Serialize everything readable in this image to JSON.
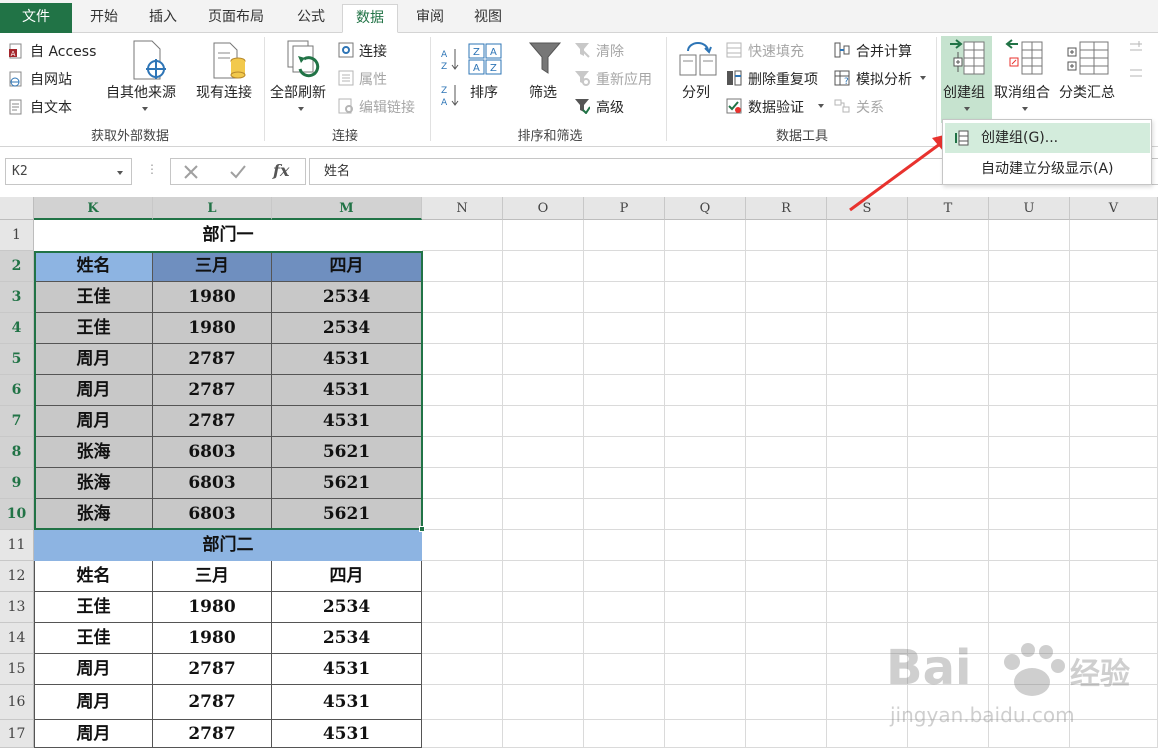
{
  "tabs": [
    "文件",
    "开始",
    "插入",
    "页面布局",
    "公式",
    "数据",
    "审阅",
    "视图"
  ],
  "active_tab": "数据",
  "ribbon": {
    "get_external_data": {
      "from_access": "自 Access",
      "from_web": "自网站",
      "from_text": "自文本",
      "from_other": "自其他来源",
      "existing_connections": "现有连接",
      "label": "获取外部数据"
    },
    "connections": {
      "refresh_all": "全部刷新",
      "connections": "连接",
      "properties": "属性",
      "edit_links": "编辑链接",
      "label": "连接"
    },
    "sort_filter": {
      "sort": "排序",
      "filter": "筛选",
      "clear": "清除",
      "reapply": "重新应用",
      "advanced": "高级",
      "label": "排序和筛选"
    },
    "data_tools": {
      "text_to_columns": "分列",
      "flash_fill": "快速填充",
      "remove_duplicates": "删除重复项",
      "data_validation": "数据验证",
      "consolidate": "合并计算",
      "what_if": "模拟分析",
      "relationships": "关系",
      "label": "数据工具"
    },
    "outline": {
      "group": "创建组",
      "ungroup": "取消组合",
      "subtotal": "分类汇总"
    }
  },
  "group_menu": {
    "items": [
      "创建组(G)...",
      "自动建立分级显示(A)"
    ]
  },
  "formula_bar": {
    "name_box": "K2",
    "formula": "姓名"
  },
  "columns": [
    "K",
    "L",
    "M",
    "N",
    "O",
    "P",
    "Q",
    "R",
    "S",
    "T",
    "U",
    "V"
  ],
  "rows": [
    "1",
    "2",
    "3",
    "4",
    "5",
    "6",
    "7",
    "8",
    "9",
    "10",
    "11",
    "12",
    "13",
    "14",
    "15",
    "16",
    "17"
  ],
  "sheet": {
    "dept1_title": "部门一",
    "dept1_header": [
      "姓名",
      "三月",
      "四月"
    ],
    "dept1_rows": [
      [
        "王佳",
        "1980",
        "2534"
      ],
      [
        "王佳",
        "1980",
        "2534"
      ],
      [
        "周月",
        "2787",
        "4531"
      ],
      [
        "周月",
        "2787",
        "4531"
      ],
      [
        "周月",
        "2787",
        "4531"
      ],
      [
        "张海",
        "6803",
        "5621"
      ],
      [
        "张海",
        "6803",
        "5621"
      ],
      [
        "张海",
        "6803",
        "5621"
      ]
    ],
    "dept2_title": "部门二",
    "dept2_header": [
      "姓名",
      "三月",
      "四月"
    ],
    "dept2_rows": [
      [
        "王佳",
        "1980",
        "2534"
      ],
      [
        "王佳",
        "1980",
        "2534"
      ],
      [
        "周月",
        "2787",
        "4531"
      ],
      [
        "周月",
        "2787",
        "4531"
      ],
      [
        "周月",
        "2787",
        "4531"
      ]
    ]
  },
  "watermark": {
    "brand": "Bai",
    "brand_suffix": "经验",
    "url": "jingyan.baidu.com"
  },
  "colors": {
    "excel_green": "#217346",
    "header_blue": "#8db4e2",
    "header_dark_blue": "#6f8fbf",
    "selected_gray": "#c8c8c8",
    "arrow_red": "#e8322e"
  }
}
